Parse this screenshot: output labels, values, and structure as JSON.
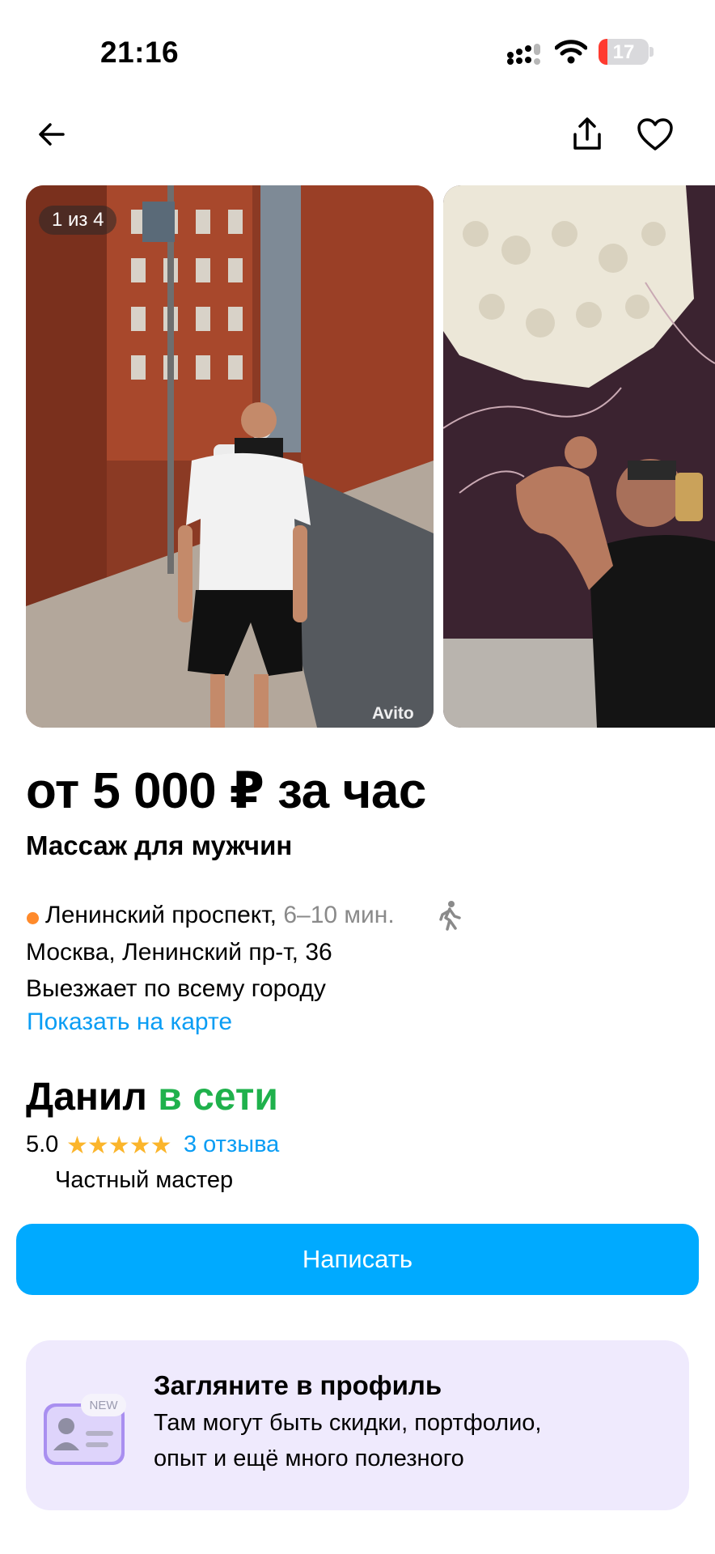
{
  "status_bar": {
    "time": "21:16",
    "battery": "17",
    "battery_level": 0.17
  },
  "gallery": {
    "counter": "1 из 4",
    "watermark": "Avito"
  },
  "listing": {
    "price": "от 5 000 ₽ за час",
    "title": "Массаж для мужчин",
    "metro_station": "Ленинский проспект,",
    "metro_distance": "6–10 мин.",
    "address": "Москва, Ленинский пр-т, 36",
    "travel_note": "Выезжает по всему городу",
    "map_link": "Показать на карте"
  },
  "seller": {
    "name": "Данил",
    "status": "в сети",
    "rating": "5.0",
    "stars": "★★★★★",
    "reviews": "3 отзыва",
    "type": "Частный мастер"
  },
  "actions": {
    "write": "Написать"
  },
  "promo": {
    "badge": "NEW",
    "title": "Загляните в профиль",
    "line1": "Там могут быть скидки, портфолио,",
    "line2": "опыт и ещё много полезного"
  },
  "colors": {
    "accent": "#00aaff",
    "link": "#0a9df4",
    "online": "#1fb14c",
    "stars": "#fbb52b",
    "metro": "#ff8a2b",
    "promo_bg": "#efeafd"
  },
  "icons": [
    "back-arrow-icon",
    "share-icon",
    "heart-icon",
    "walking-icon",
    "signal-icon",
    "wifi-icon",
    "battery-icon",
    "profile-card-icon"
  ]
}
